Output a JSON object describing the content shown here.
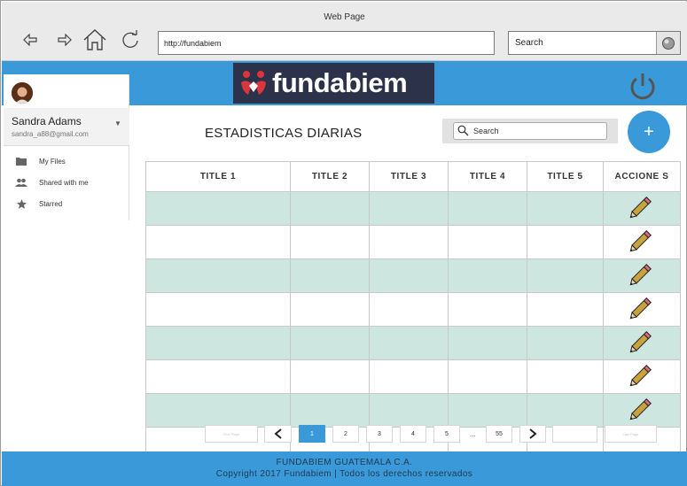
{
  "browser": {
    "window_title": "Web Page",
    "url": "http://fundabiem",
    "search_placeholder": "Search"
  },
  "header": {
    "logo_text": "fundabiem"
  },
  "sidebar": {
    "user_name": "Sandra Adams",
    "user_email": "sandra_a88@gmail.com",
    "items": [
      {
        "label": "My Files",
        "icon": "folder-icon"
      },
      {
        "label": "Shared with me",
        "icon": "people-icon"
      },
      {
        "label": "Starred",
        "icon": "star-icon"
      }
    ]
  },
  "main": {
    "title": "ESTADISTICAS DIARIAS",
    "search_placeholder": "Search",
    "add_button": "+"
  },
  "table": {
    "columns": [
      "TITLE 1",
      "TITLE 2",
      "TITLE 3",
      "TITLE 4",
      "TITLE 5",
      "ACCIONE S"
    ]
  },
  "pagination": {
    "first": "First Page",
    "pages": [
      "1",
      "2",
      "3",
      "4",
      "5",
      "55"
    ],
    "ellipsis": "...",
    "last": "Last Page",
    "current": "1"
  },
  "footer": {
    "line1": "FUNDABIEM GUATEMALA C.A.",
    "line2": "Copyright 2017 Fundabiem | Todos los derechos reservados"
  },
  "colors": {
    "accent": "#3a9ad9",
    "row_shade": "#cde6df",
    "logo_bg": "#2b3249"
  }
}
